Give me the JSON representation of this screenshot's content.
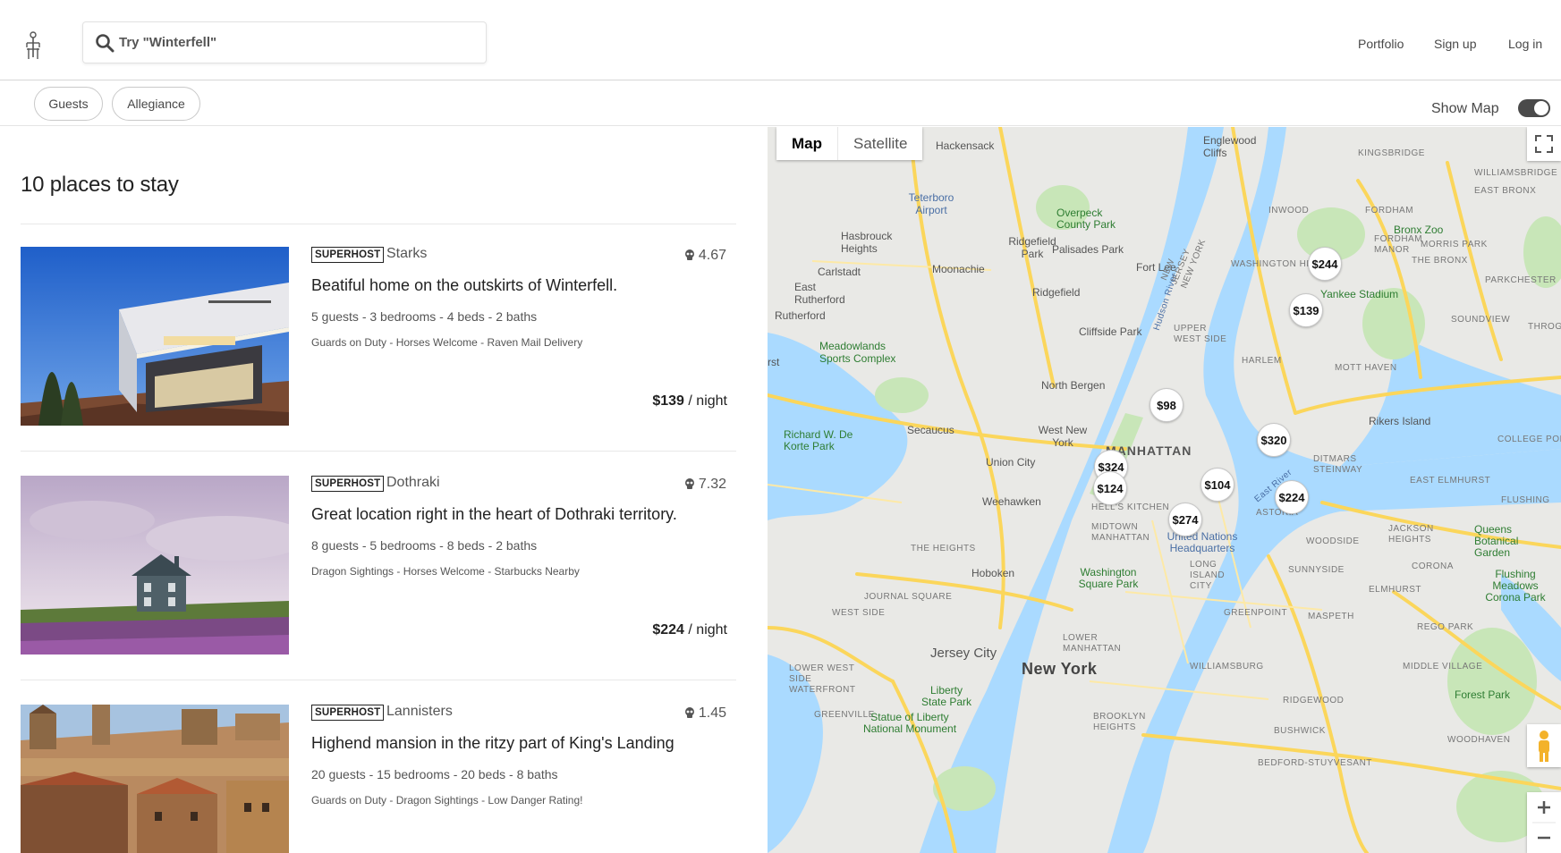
{
  "header": {
    "search_placeholder": "Try \"Winterfell\"",
    "nav": [
      "Portfolio",
      "Sign up",
      "Log in"
    ]
  },
  "filters": {
    "pills": [
      "Guests",
      "Allegiance"
    ],
    "show_map_label": "Show Map",
    "show_map_on": true
  },
  "results": {
    "heading": "10 places to stay",
    "listings": [
      {
        "badge": "SUPERHOST",
        "house": "Starks",
        "rating": "4.67",
        "title": "Beatiful home on the outskirts of Winterfell.",
        "stats": "5 guests - 3 bedrooms - 4 beds - 2 baths",
        "amenities": "Guards on Duty - Horses Welcome - Raven Mail Delivery",
        "price": "$139",
        "unit": "/ night"
      },
      {
        "badge": "SUPERHOST",
        "house": "Dothraki",
        "rating": "7.32",
        "title": "Great location right in the heart of Dothraki territory.",
        "stats": "8 guests - 5 bedrooms - 8 beds - 2 baths",
        "amenities": "Dragon Sightings - Horses Welcome - Starbucks Nearby",
        "price": "$224",
        "unit": "/ night"
      },
      {
        "badge": "SUPERHOST",
        "house": "Lannisters",
        "rating": "1.45",
        "title": "Highend mansion in the ritzy part of King's Landing",
        "stats": "20 guests - 15 bedrooms - 20 beds - 8 baths",
        "amenities": "Guards on Duty - Dragon Sightings - Low Danger Rating!",
        "price": "",
        "unit": ""
      }
    ]
  },
  "map": {
    "type_buttons": [
      "Map",
      "Satellite"
    ],
    "active_type": "Map",
    "markers": [
      "$244",
      "$139",
      "$98",
      "$320",
      "$324",
      "$104",
      "$124",
      "$224",
      "$274"
    ],
    "labels": {
      "hackensack": "Hackensack",
      "englewood": "Englewood Cliffs",
      "kingsbridge": "KINGSBRIDGE",
      "williamsbridge": "WILLIAMSBRIDGE",
      "teterboro": "Teterboro Airport",
      "eastbronx": "EAST BRONX",
      "overpeck": "Overpeck County Park",
      "inwood": "INWOOD",
      "fordham": "FORDHAM",
      "hasbrouck": "Hasbrouck Heights",
      "ridgefieldpark": "Ridgefield Park",
      "fortlee": "Fort Lee",
      "fordhammanor": "FORDHAM MANOR",
      "bronxzoo": "Bronx Zoo",
      "morrispark": "MORRIS PARK",
      "palisades": "Palisades Park",
      "washheights": "WASHINGTON HEIGHTS",
      "carlstadt": "Carlstadt",
      "moonachie": "Moonachie",
      "thebronx": "THE BRONX",
      "parkchester": "PARKCHESTER",
      "eastrutherford": "East Rutherford",
      "ridgefield": "Ridgefield",
      "yankee": "Yankee Stadium",
      "rutherford": "Rutherford",
      "soundview": "SOUNDVIEW",
      "cliffside": "Cliffside Park",
      "upperwest": "UPPER WEST SIDE",
      "throggs": "THROGS NE",
      "meadowlands": "Meadowlands Sports Complex",
      "harlem": "HARLEM",
      "motthaven": "MOTT HAVEN",
      "northbergen": "North Bergen",
      "rikers": "Rikers Island",
      "richard": "Richard W. De Korte Park",
      "secaucus": "Secaucus",
      "westny": "West New York",
      "collegepoint": "COLLEGE POINT",
      "manhattan": "MANHATTAN",
      "unioncity": "Union City",
      "ditmars": "DITMARS STEINWAY",
      "eastelmhurst": "EAST ELMHURST",
      "flushing": "FLUSHING",
      "weehawken": "Weehawken",
      "hellskitchen": "HELL'S KITCHEN",
      "astoria": "ASTORIA",
      "queensbg": "Queens Botanical Garden",
      "jacksonheights": "JACKSON HEIGHTS",
      "midtown": "MIDTOWN MANHATTAN",
      "unitednations": "United Nations Headquarters",
      "woodside": "WOODSIDE",
      "theheights": "THE HEIGHTS",
      "hoboken": "Hoboken",
      "washsquare": "Washington Square Park",
      "lic": "LONG ISLAND CITY",
      "sunnyside": "SUNNYSIDE",
      "corona": "CORONA",
      "flushingmeadows": "Flushing Meadows Corona Park",
      "journalsquare": "JOURNAL SQUARE",
      "westside": "WEST SIDE",
      "elmhurst": "ELMHURST",
      "greenpoint": "GREENPOINT",
      "maspeth": "MASPETH",
      "regopark": "REGO PARK",
      "jerseycity": "Jersey City",
      "lowermanhattan": "LOWER MANHATTAN",
      "newyork": "New York",
      "lowerwest": "LOWER WEST SIDE WATERFRONT",
      "williamsburg": "WILLIAMSBURG",
      "middlevillage": "MIDDLE VILLAGE",
      "libertystate": "Liberty State Park",
      "ridgewood": "RIDGEWOOD",
      "forestpark": "Forest Park",
      "greenville": "GREENVILLE",
      "statueofliberty": "Statue of Liberty National Monument",
      "brooklynheights": "BROOKLYN HEIGHTS",
      "bushwick": "BUSHWICK",
      "woodhaven": "WOODHAVEN",
      "bedstuy": "BEDFORD-STUYVESANT",
      "hudsonriver": "Hudson River",
      "eastriver": "East River",
      "newjersey": "NEW JERSEY NEW YORK",
      "rt": "rst"
    },
    "colors": {
      "land": "#e9e9e6",
      "water": "#aadaff",
      "park": "#c8e6b8",
      "road": "#fbd65b"
    }
  }
}
